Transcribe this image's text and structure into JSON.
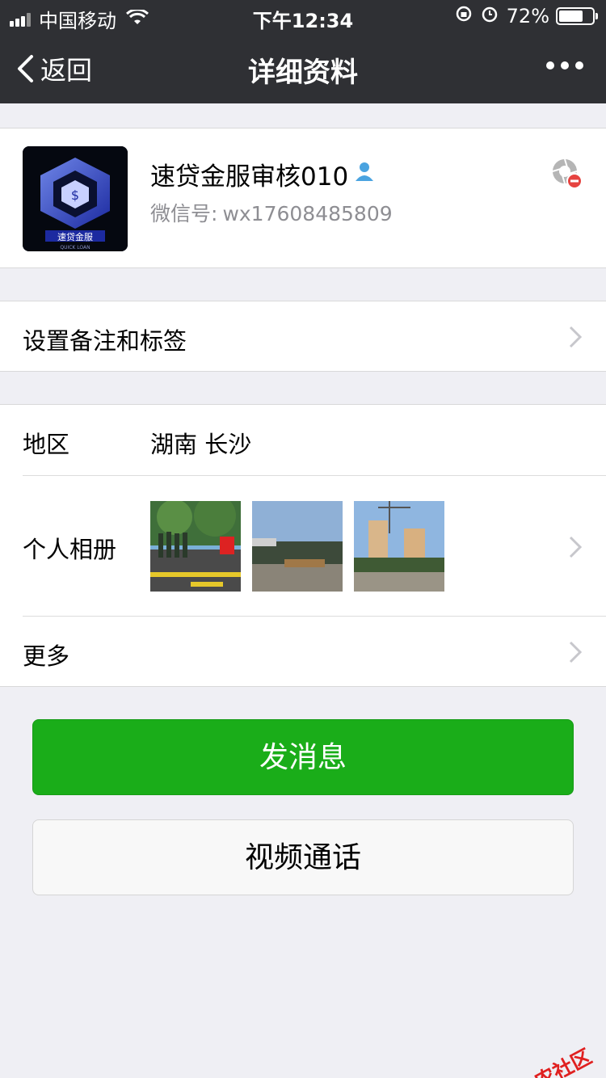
{
  "status_bar": {
    "carrier": "中国移动",
    "time": "下午12:34",
    "battery_text": "72%",
    "battery_level": 0.72
  },
  "nav": {
    "back_label": "返回",
    "title": "详细资料"
  },
  "profile": {
    "name": "速贷金服审核010",
    "wechat_id_label": "微信号:",
    "wechat_id": "wx17608485809",
    "avatar_text": "速贷金服",
    "avatar_subtext": "QUICK LOAN"
  },
  "remark": {
    "label": "设置备注和标签"
  },
  "details": {
    "region_label": "地区",
    "region_value": "湖南 长沙",
    "album_label": "个人相册",
    "more_label": "更多"
  },
  "actions": {
    "send_message": "发消息",
    "video_call": "视频通话"
  },
  "watermark": "卡农社区",
  "colors": {
    "nav_bg": "#2f3034",
    "primary_green": "#1aad19",
    "page_bg": "#efeff4"
  }
}
